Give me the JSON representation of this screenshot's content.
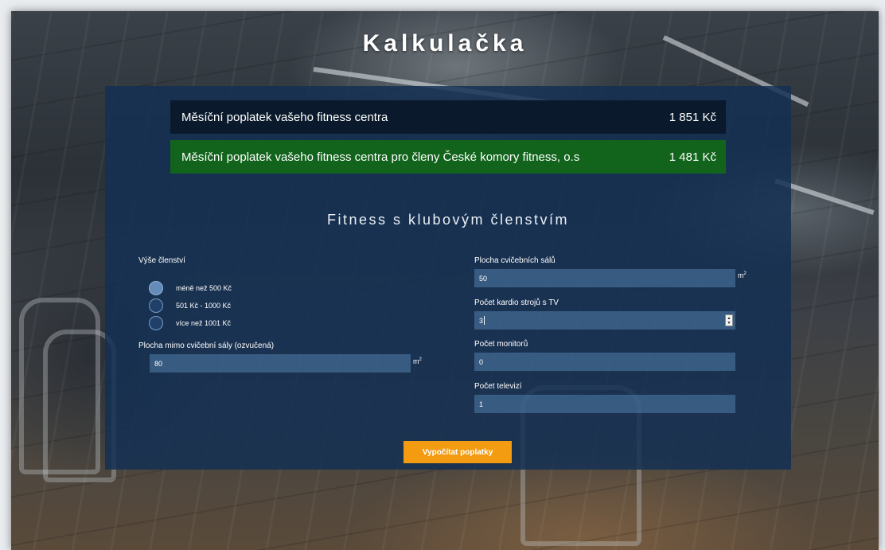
{
  "header": {
    "title": "Kalkulačka"
  },
  "results": {
    "regular": {
      "label": "Měsíční poplatek vašeho fitness centra",
      "value": "1 851 Kč"
    },
    "member": {
      "label": "Měsíční poplatek vašeho fitness centra pro členy České komory fitness, o.s",
      "value": "1 481 Kč"
    }
  },
  "form": {
    "section_title": "Fitness s klubovým členstvím",
    "membership": {
      "label": "Výše členství",
      "options": [
        "méně než 500 Kč",
        "501 Kč - 1000 Kč",
        "více než 1001 Kč"
      ],
      "selected": "méně než 500 Kč"
    },
    "area_outside": {
      "label": "Plocha mimo cvičební sály (ozvučená)",
      "value": "80",
      "unit": "m",
      "unit_sup": "2"
    },
    "area_halls": {
      "label": "Plocha cvičebních sálů",
      "value": "50",
      "unit": "m",
      "unit_sup": "2"
    },
    "cardio": {
      "label": "Počet kardio strojů s TV",
      "value": "3"
    },
    "monitors": {
      "label": "Počet monitorů",
      "value": "0"
    },
    "tvs": {
      "label": "Počet televizí",
      "value": "1"
    },
    "submit_label": "Vypočítat poplatky"
  },
  "colors": {
    "panel": "#133054",
    "fee_dark": "#0a1a2c",
    "fee_green": "#12641c",
    "button": "#f39c12"
  }
}
